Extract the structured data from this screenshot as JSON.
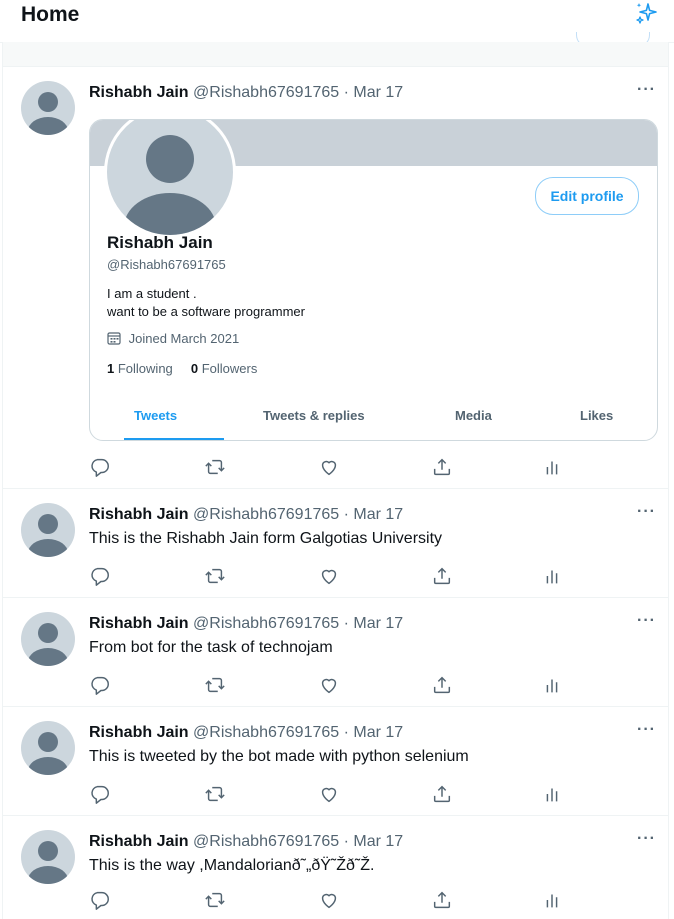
{
  "header": {
    "title": "Home",
    "sparkle_icon": "sparkle-icon"
  },
  "colors": {
    "accent": "#1d9bf0",
    "text": "#0f1419",
    "muted": "#536471",
    "avatar_bg": "#ccd6dd",
    "avatar_fg": "#657786",
    "banner": "#c9d1d8"
  },
  "tweets": [
    {
      "name": "Rishabh Jain",
      "meta": "@Rishabh67691765 · Mar 17",
      "text": "",
      "more": "···",
      "profile_card": {
        "edit_label": "Edit profile",
        "name": "Rishabh Jain",
        "handle": "@Rishabh67691765",
        "bio_line1": "I am a student .",
        "bio_line2": "want to be a software programmer",
        "joined": "Joined March 2021",
        "following_count": "1",
        "following_label": "Following",
        "followers_count": "0",
        "followers_label": "Followers",
        "tabs": [
          "Tweets",
          "Tweets & replies",
          "Media",
          "Likes"
        ],
        "active_tab": "Tweets"
      }
    },
    {
      "name": "Rishabh Jain",
      "meta": "@Rishabh67691765 · Mar 17",
      "text": "This is the Rishabh Jain form Galgotias University",
      "more": "···"
    },
    {
      "name": "Rishabh Jain",
      "meta": "@Rishabh67691765 · Mar 17",
      "text": "From bot for the task of technojam",
      "more": "···"
    },
    {
      "name": "Rishabh Jain",
      "meta": "@Rishabh67691765 · Mar 17",
      "text": "This is tweeted by the bot made with python selenium",
      "more": "···"
    },
    {
      "name": "Rishabh Jain",
      "meta": "@Rishabh67691765 · Mar 17",
      "text": "This is the way ,Mandalorianð˜„ðŸ˜Žð˜Ž.",
      "more": "···"
    }
  ],
  "actions": [
    "reply-icon",
    "retweet-icon",
    "like-icon",
    "share-icon",
    "analytics-icon"
  ]
}
